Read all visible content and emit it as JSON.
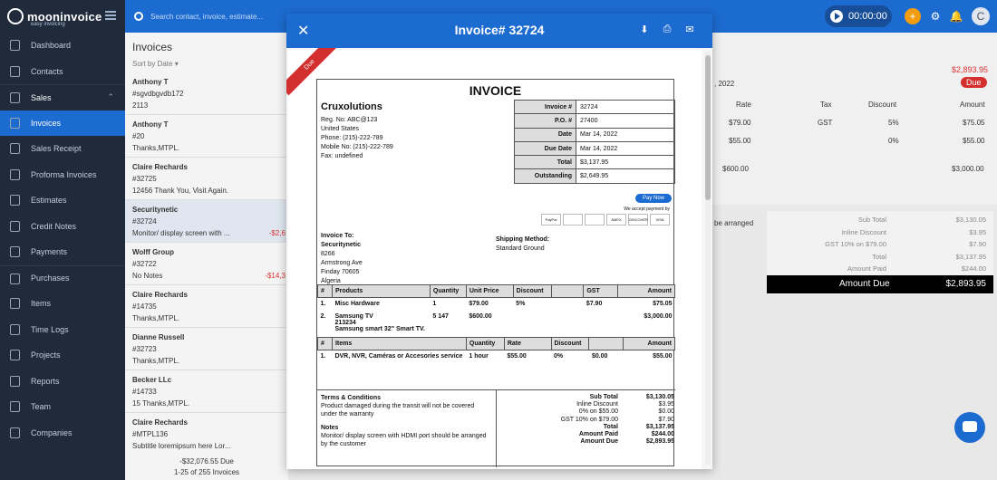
{
  "brand": {
    "name": "mooninvoice",
    "tagline": "easy invoicing"
  },
  "search": {
    "placeholder": "Search contact, invoice, estimate..."
  },
  "timer": {
    "value": "00:00:00"
  },
  "avatar": "C",
  "sidebar": {
    "items": [
      {
        "label": "Dashboard",
        "active": false
      },
      {
        "label": "Contacts",
        "active": false
      },
      {
        "label": "Sales",
        "active": false,
        "head": true
      },
      {
        "label": "Invoices",
        "active": true
      },
      {
        "label": "Sales Receipt",
        "active": false
      },
      {
        "label": "Proforma Invoices",
        "active": false
      },
      {
        "label": "Estimates",
        "active": false
      },
      {
        "label": "Credit Notes",
        "active": false
      },
      {
        "label": "Payments",
        "active": false
      },
      {
        "label": "Purchases",
        "active": false
      },
      {
        "label": "Items",
        "active": false
      },
      {
        "label": "Time Logs",
        "active": false
      },
      {
        "label": "Projects",
        "active": false
      },
      {
        "label": "Reports",
        "active": false
      },
      {
        "label": "Team",
        "active": false
      },
      {
        "label": "Companies",
        "active": false
      }
    ]
  },
  "list": {
    "title": "Invoices",
    "sort": "Sort by Date",
    "items": [
      {
        "name": "Anthony T",
        "num": "#sgvdbgvdb172",
        "note": "2113",
        "amt": ""
      },
      {
        "name": "Anthony T",
        "num": "#20",
        "note": "Thanks,MTPL.",
        "amt": ""
      },
      {
        "name": "Claire Rechards",
        "num": "#32725",
        "note": "12456 Thank You, Visit Again.",
        "amt": ""
      },
      {
        "name": "Securitynetic",
        "num": "#32724",
        "note": "Monitor/ display screen with ...",
        "amt": "-$2,6"
      },
      {
        "name": "Wolff Group",
        "num": "#32722",
        "note": "No Notes",
        "amt": "-$14,3"
      },
      {
        "name": "Claire Rechards",
        "num": "#14735",
        "note": "Thanks,MTPL.",
        "amt": ""
      },
      {
        "name": "Dianne Russell",
        "num": "#32723",
        "note": "Thanks,MTPL.",
        "amt": ""
      },
      {
        "name": "Becker LLc",
        "num": "#14733",
        "note": "15 Thanks,MTPL.",
        "amt": ""
      },
      {
        "name": "Claire Rechards",
        "num": "#MTPL136",
        "note": "Subtitle loremipsum here Lor...",
        "amt": ""
      }
    ],
    "footer_due": "-$32,076.55  Due",
    "footer_range": "1-25 of 255 Invoices"
  },
  "background": {
    "amount_top": "$2,893.95",
    "date": ", 2022",
    "due_badge": "Due",
    "headers": [
      "Rate",
      "Tax",
      "Discount",
      "Amount"
    ],
    "row1": [
      "$79.00",
      "GST",
      "5%",
      "$75.05"
    ],
    "row2": [
      "$55.00",
      "0%",
      "$55.00"
    ],
    "subtotal_left": "$600.00",
    "subtotal_right": "$3,000.00",
    "arranged": "be arranged",
    "totals": [
      {
        "label": "Sub Total",
        "value": "$3,130.05"
      },
      {
        "label": "Inline Discount",
        "value": "$3.95"
      },
      {
        "label": "GST 10% on $79.00",
        "value": "$7.90"
      },
      {
        "label": "Total",
        "value": "$3,137.95"
      },
      {
        "label": "Amount Paid",
        "value": "$244.00"
      }
    ],
    "amount_due_label": "Amount Due",
    "amount_due_value": "$2,893.95"
  },
  "modal": {
    "title": "Invoice# 32724",
    "ribbon": "Due",
    "invoice": {
      "heading": "INVOICE",
      "company": "Cruxolutions",
      "company_lines": [
        "Reg. No: ABC@123",
        "United States",
        "Phone: (215)-222-789",
        "Mobile No: (215)-222-789",
        "Fax: undefined"
      ],
      "meta": [
        {
          "k": "Invoice #",
          "v": "32724"
        },
        {
          "k": "P.O. #",
          "v": "27400"
        },
        {
          "k": "Date",
          "v": "Mar 14, 2022"
        },
        {
          "k": "Due Date",
          "v": "Mar 14, 2022"
        },
        {
          "k": "Total",
          "v": "$3,137.95"
        },
        {
          "k": "Outstanding",
          "v": "$2,649.95"
        }
      ],
      "pay_now": "Pay Now",
      "accept": "We accept payment by",
      "cards": [
        "PayPal",
        "",
        "",
        "AMEX",
        "DISCOVER",
        "VISA"
      ],
      "bill_to_label": "Invoice To:",
      "bill_to": [
        "Securitynetic",
        "8266",
        "Armstrong Ave",
        "Finday  70605",
        "Algeria"
      ],
      "ship_label": "Shipping Method:",
      "ship_value": "Standard Ground",
      "products_headers": [
        "#",
        "Products",
        "Quantity",
        "Unit Price",
        "Discount",
        "",
        "GST",
        "Amount"
      ],
      "products": [
        {
          "n": "1.",
          "name": "Misc Hardware",
          "sub": "",
          "qty": "1",
          "price": "$79.00",
          "disc": "5%",
          "gst": "$7.90",
          "amt": "$75.05"
        },
        {
          "n": "2.",
          "name": "Samsung TV",
          "sub": "213234",
          "sub2": "Samsung smart 32\" Smart TV.",
          "qty": "5 147",
          "price": "$600.00",
          "disc": "",
          "gst": "",
          "amt": "$3,000.00"
        }
      ],
      "items_headers": [
        "#",
        "Items",
        "Quantity",
        "Rate",
        "Discount",
        "",
        "Amount"
      ],
      "items": [
        {
          "n": "1.",
          "name": "DVR, NVR, Caméras or Accesories service",
          "qty": "1 hour",
          "rate": "$55.00",
          "disc": "0%",
          "x": "$0.00",
          "amt": "$55.00"
        }
      ],
      "terms_label": "Terms & Conditions",
      "terms": "Product damaged during the transit will not be covered under the warranty",
      "notes_label": "Notes",
      "notes": "Monitor/ display screen with HDMI port should be arranged by the customer",
      "summary": [
        {
          "l": "Sub Total",
          "v": "$3,130.05",
          "b": true
        },
        {
          "l": "Inline Discount",
          "v": "$3.95",
          "b": false
        },
        {
          "l": "0% on $55.00",
          "v": "$0.00",
          "b": false
        },
        {
          "l": "GST 10% on $79.00",
          "v": "$7.90",
          "b": false
        },
        {
          "l": "Total",
          "v": "$3,137.95",
          "b": true
        },
        {
          "l": "Amount Paid",
          "v": "$244.00",
          "b": true
        },
        {
          "l": "Amount Due",
          "v": "$2,893.95",
          "b": true
        }
      ]
    }
  },
  "colors": {
    "primary": "#1c6bd0",
    "sidebar": "#1f2a3a",
    "due": "#d32f2f"
  }
}
